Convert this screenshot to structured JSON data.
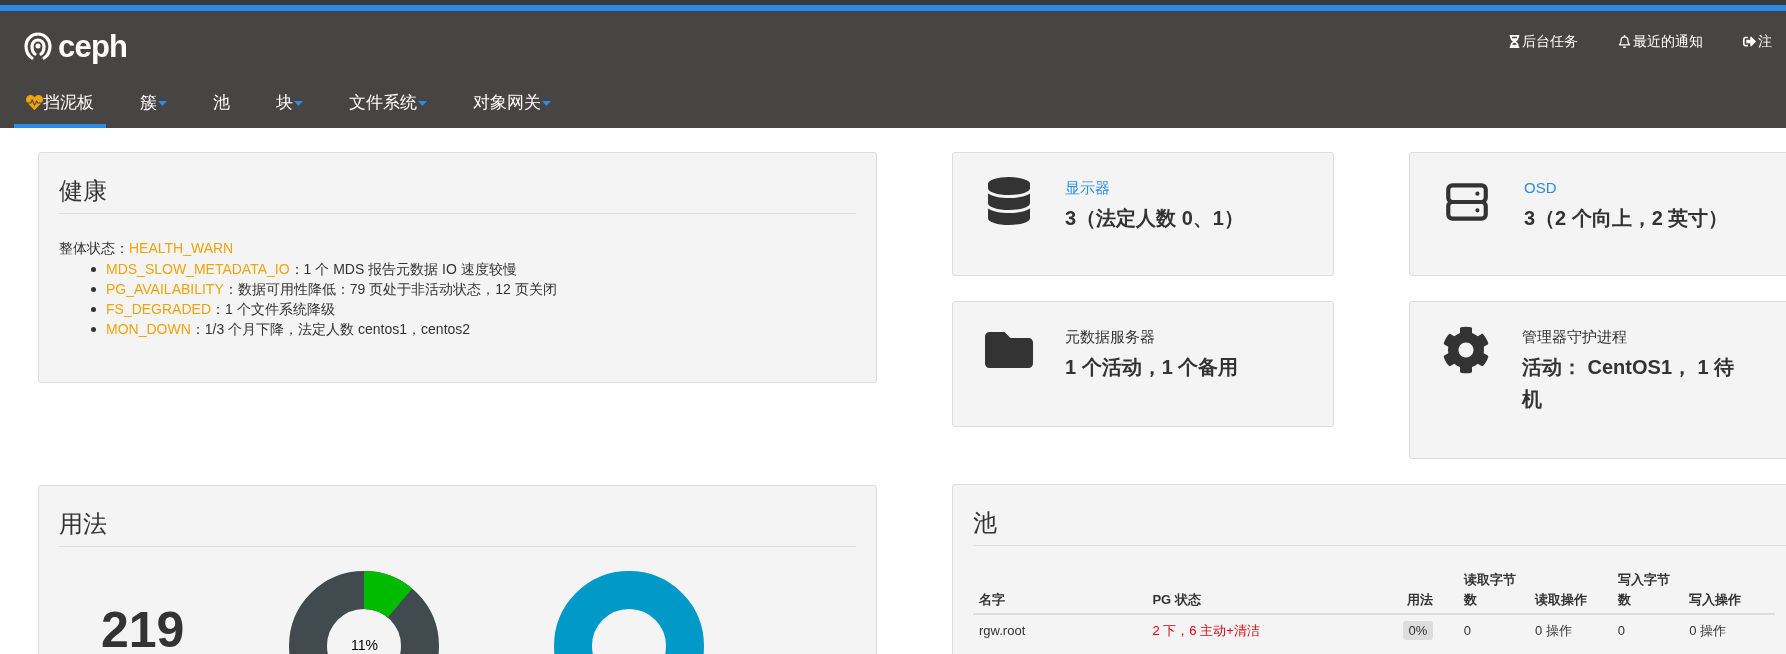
{
  "header": {
    "logo": "ceph",
    "top_links": [
      {
        "kind": "hourglass",
        "label": "后台任务"
      },
      {
        "kind": "bell",
        "label": "最近的通知"
      },
      {
        "kind": "logout",
        "label": "注"
      }
    ],
    "nav": [
      {
        "label": "挡泥板",
        "selected": true,
        "dropdown": false,
        "kind": "heart"
      },
      {
        "label": "簇",
        "selected": false,
        "dropdown": true
      },
      {
        "label": "池",
        "selected": false,
        "dropdown": false
      },
      {
        "label": "块",
        "selected": false,
        "dropdown": true
      },
      {
        "label": "文件系统",
        "selected": false,
        "dropdown": true
      },
      {
        "label": "对象网关",
        "selected": false,
        "dropdown": true
      }
    ]
  },
  "health": {
    "title": "健康",
    "status_label": "整体状态：",
    "status": "HEALTH_WARN",
    "checks": [
      {
        "code": "MDS_SLOW_METADATA_IO",
        "text": "：1 个 MDS 报告元数据 IO 速度较慢"
      },
      {
        "code": "PG_AVAILABILITY",
        "text": "：数据可用性降低：79 页处于非活动状态，12 页关闭"
      },
      {
        "code": "FS_DEGRADED",
        "text": "：1 个文件系统降级"
      },
      {
        "code": "MON_DOWN",
        "text": "：1/3 个月下降，法定人数 centos1，centos2"
      }
    ]
  },
  "cards": [
    {
      "kind": "database",
      "title": "显示器",
      "link": true,
      "value": "3（法定人数 0、1）"
    },
    {
      "kind": "drive",
      "title": "OSD",
      "link": true,
      "value": "3（2 个向上，2 英寸）"
    },
    {
      "kind": "folder",
      "title": "元数据服务器",
      "link": false,
      "value": "1 个活动，1 个备用"
    },
    {
      "kind": "gear",
      "title": "管理器守护进程",
      "link": false,
      "value": "活动： CentOS1， 1 待机"
    }
  ],
  "usage": {
    "title": "用法",
    "total": "219",
    "donut_label": "11%"
  },
  "pools": {
    "title": "池",
    "columns": [
      "名字",
      "PG 状态",
      "用法",
      "读取字节数",
      "读取操作",
      "写入字节数",
      "写入操作"
    ],
    "rows": [
      {
        "name": "rgw.root",
        "pg_status": "2 下，6 主动+清洁",
        "usage": "0%",
        "read_bytes": "0",
        "read_ops": "0 操作",
        "write_bytes": "0",
        "write_ops": "0 操作"
      }
    ]
  }
}
